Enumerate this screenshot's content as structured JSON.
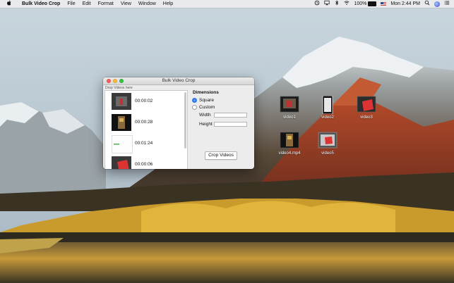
{
  "menubar": {
    "apple_icon": "apple-icon",
    "items": [
      "Bulk Video Crop",
      "File",
      "Edit",
      "Format",
      "View",
      "Window",
      "Help"
    ],
    "status": {
      "battery": "100%",
      "clock": "Mon 2:44 PM"
    }
  },
  "window": {
    "title": "Bulk Video Crop",
    "drop_label": "Drop Videos here",
    "videos": [
      {
        "duration": "00:00:02"
      },
      {
        "duration": "00:00:28"
      },
      {
        "duration": "00:01:24"
      },
      {
        "duration": "00:00:06"
      }
    ],
    "options": {
      "heading": "Dimensions",
      "square_label": "Square",
      "custom_label": "Custom",
      "width_label": "Width",
      "height_label": "Height",
      "width_value": "",
      "height_value": "",
      "selected": "Square",
      "crop_button": "Crop Videos"
    }
  },
  "desktop": {
    "files": [
      {
        "name": "video1"
      },
      {
        "name": "video2"
      },
      {
        "name": "video3"
      },
      {
        "name": "video4.mp4"
      },
      {
        "name": "video5"
      }
    ]
  },
  "colors": {
    "accent": "#3b82f6",
    "close": "#fc605c",
    "minimize": "#fdbc40",
    "maximize": "#34c84a"
  }
}
